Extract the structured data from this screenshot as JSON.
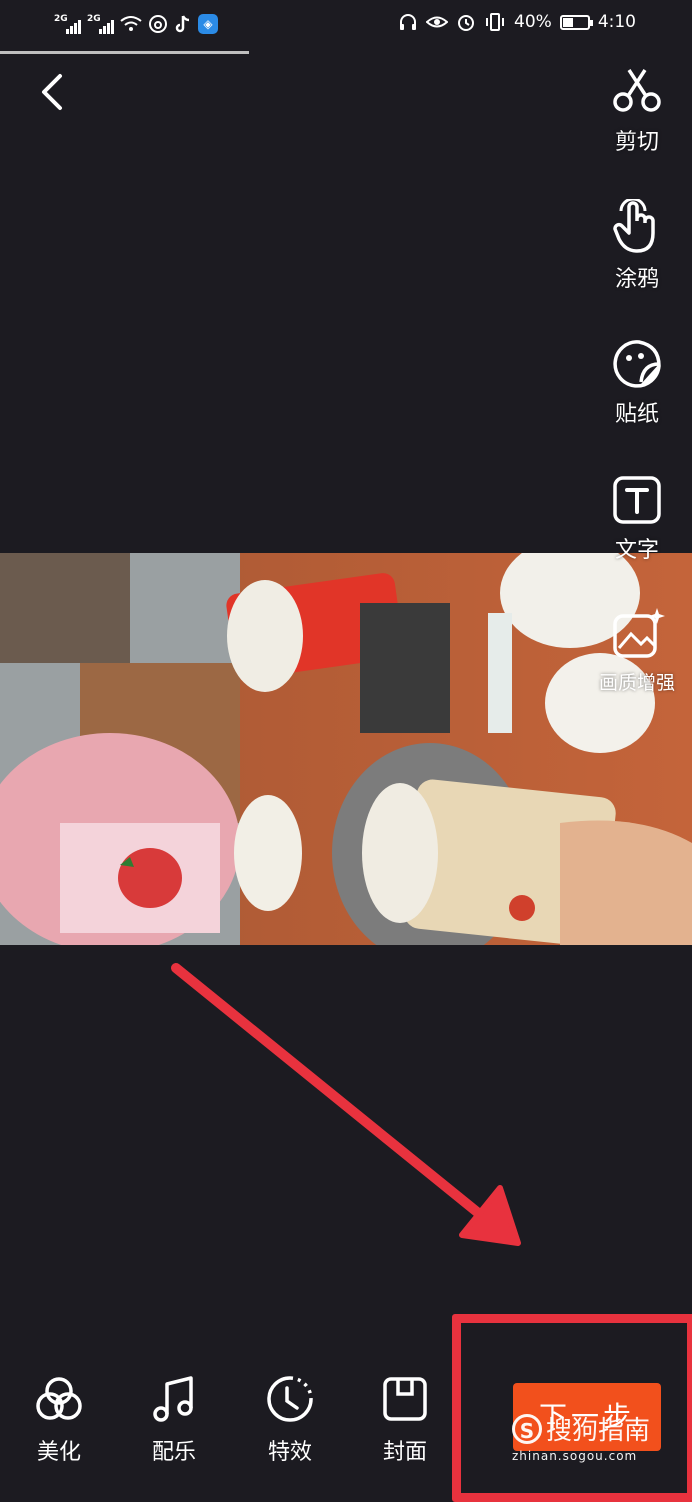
{
  "status_bar": {
    "signal1": "2G",
    "signal2": "2G",
    "battery": "40%",
    "time": "4:10"
  },
  "tools": [
    {
      "id": "cut",
      "label": "剪切",
      "icon": "scissors-icon"
    },
    {
      "id": "doodle",
      "label": "涂鸦",
      "icon": "hand-pointer-icon"
    },
    {
      "id": "sticker",
      "label": "贴纸",
      "icon": "sticker-icon"
    },
    {
      "id": "text",
      "label": "文字",
      "icon": "text-icon"
    },
    {
      "id": "enhance",
      "label": "画质增强",
      "icon": "image-enhance-icon"
    }
  ],
  "bottom_bar": {
    "beautify": "美化",
    "music": "配乐",
    "effects": "特效",
    "cover": "封面",
    "next": "下一步"
  },
  "watermark": {
    "logo": "S",
    "text": "搜狗指南",
    "url": "zhinan.sogou.com"
  },
  "colors": {
    "background": "#1c1b21",
    "next_button": "#f2501c",
    "annotation_red": "#e8323e"
  }
}
